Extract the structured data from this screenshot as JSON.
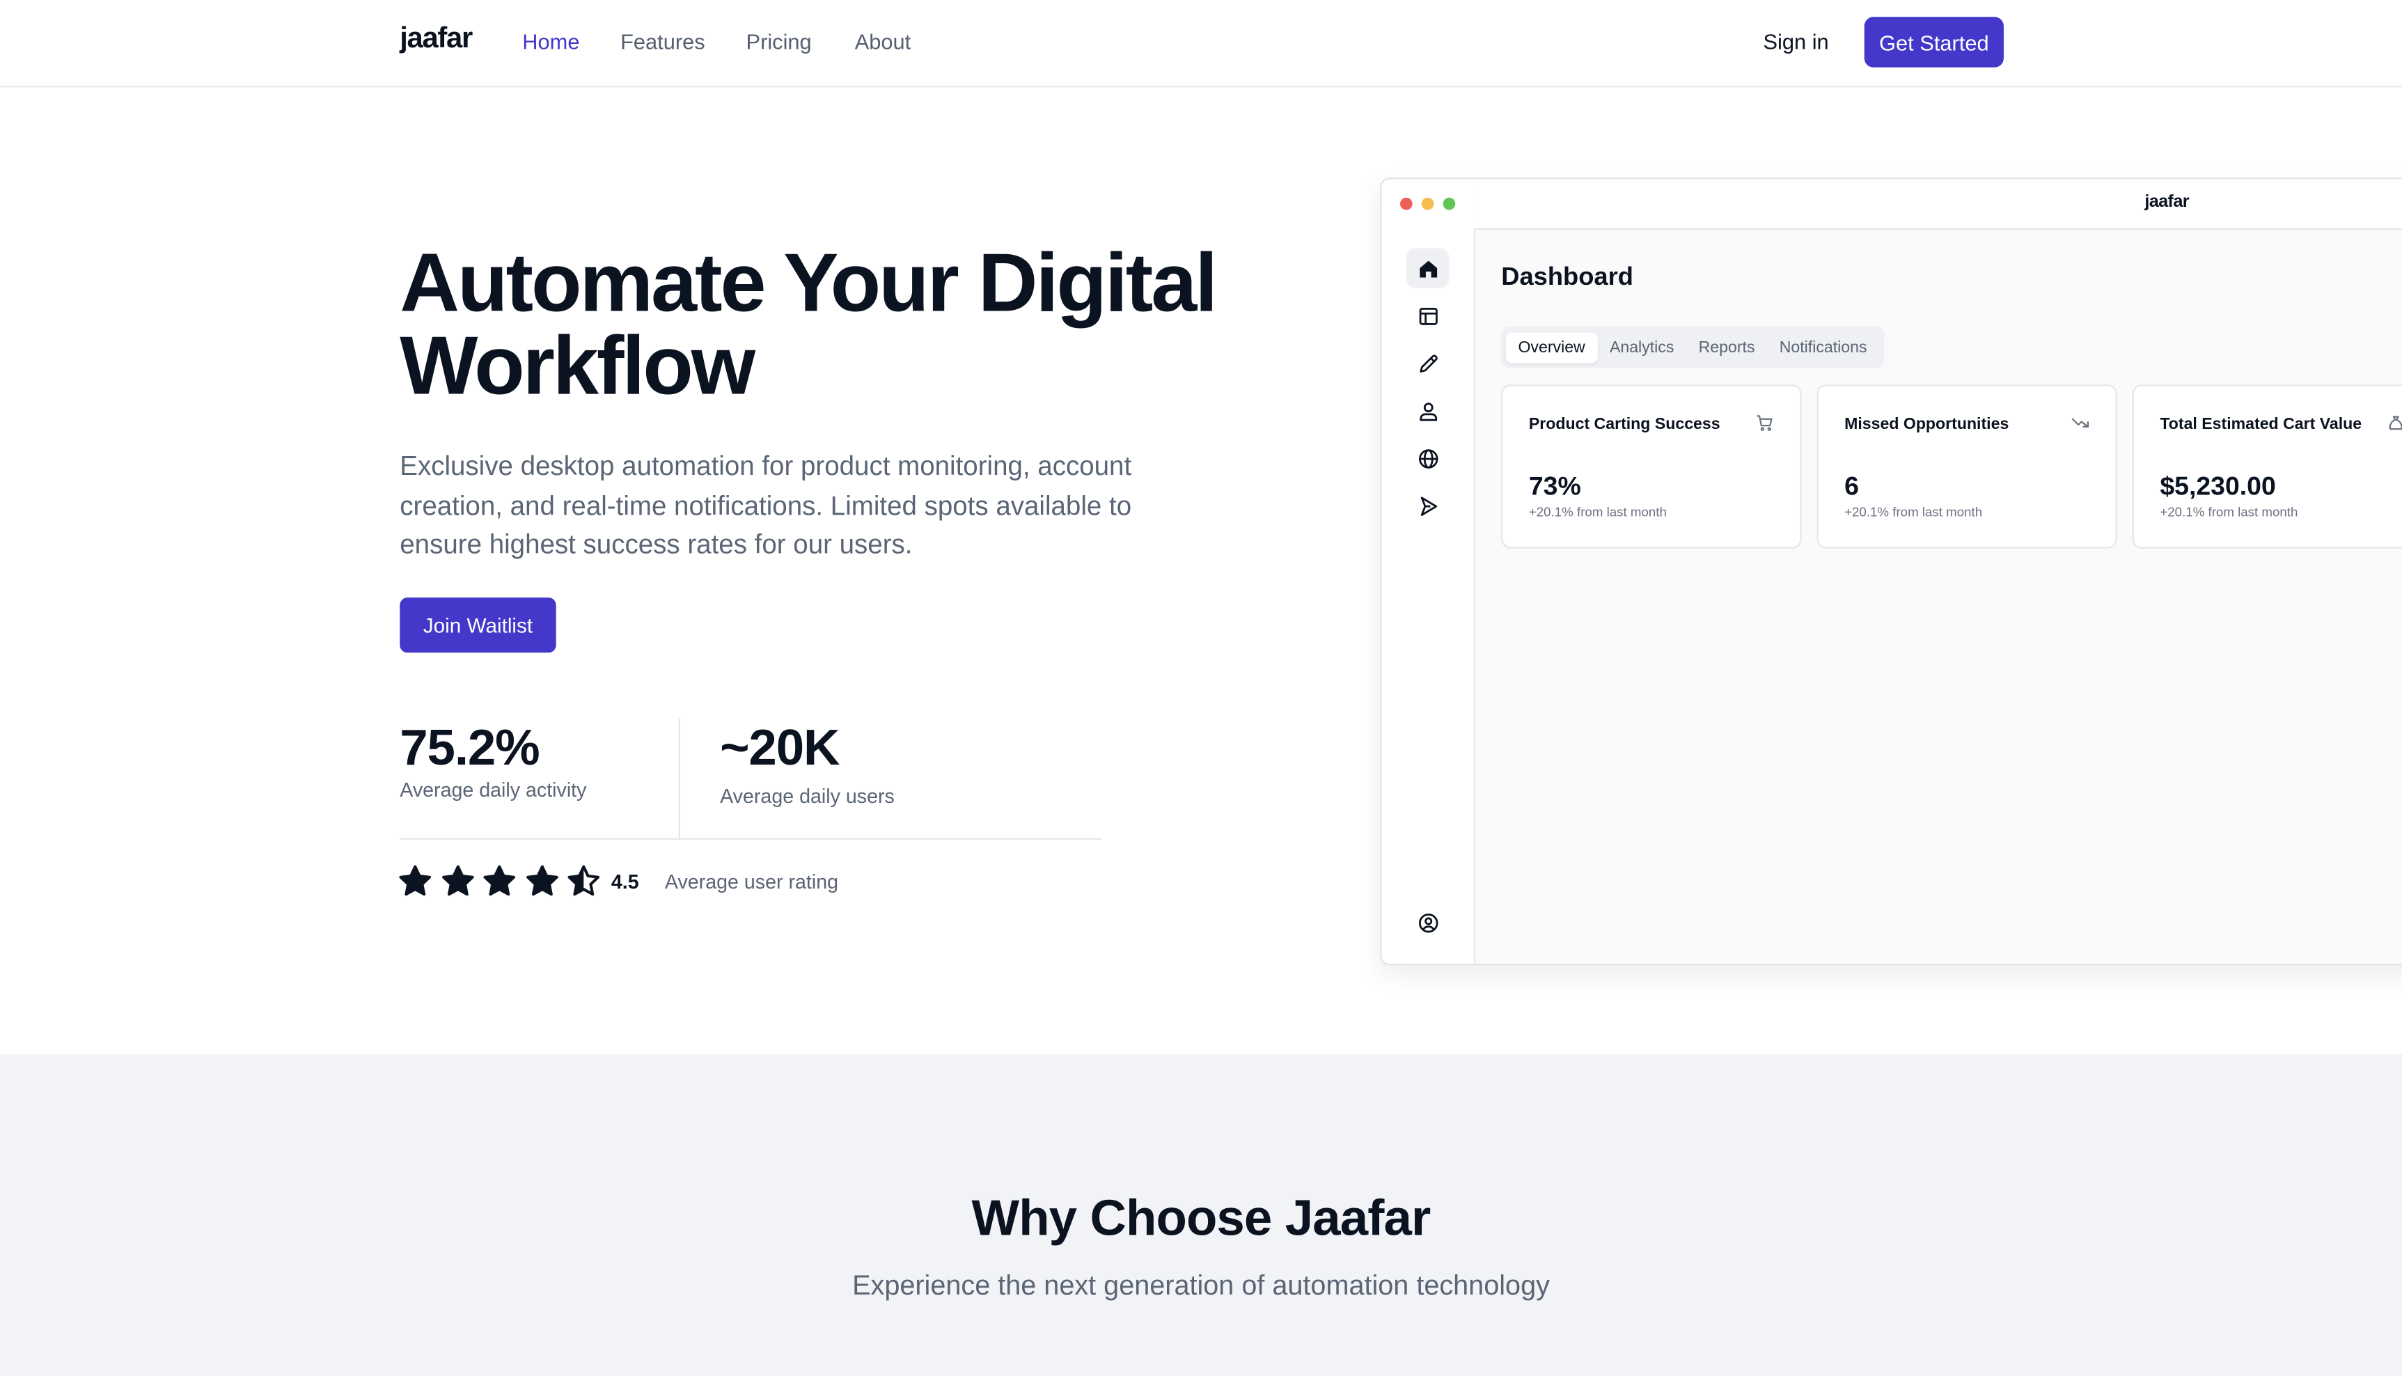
{
  "nav": {
    "logo": "jaafar",
    "links": [
      "Home",
      "Features",
      "Pricing",
      "About"
    ],
    "active_link": "Home",
    "sign_in": "Sign in",
    "cta": "Get Started"
  },
  "hero": {
    "title": "Automate Your Digital Workflow",
    "subtitle": "Exclusive desktop automation for product monitoring, account creation, and real-time notifications. Limited spots available to ensure highest success rates for our users.",
    "cta": "Join Waitlist",
    "stats": [
      {
        "value": "75.2%",
        "label": "Average daily activity"
      },
      {
        "value": "~20K",
        "label": "Average daily users"
      }
    ],
    "rating": {
      "value": "4.5",
      "stars": 4.5,
      "max": 5,
      "label": "Average user rating"
    }
  },
  "dashboard": {
    "window_controls": [
      "close",
      "minimize",
      "maximize"
    ],
    "logo": "jaafar",
    "title": "Dashboard",
    "sidebar_icons": [
      "home-icon",
      "layout-icon",
      "pencil-icon",
      "user-icon",
      "globe-icon",
      "send-icon",
      "account-circle-icon"
    ],
    "tabs": [
      "Overview",
      "Analytics",
      "Reports",
      "Notifications"
    ],
    "active_tab": "Overview",
    "cards": [
      {
        "title": "Product Carting Success",
        "value": "73%",
        "delta": "+20.1% from last month",
        "icon": "cart-icon"
      },
      {
        "title": "Missed Opportunities",
        "value": "6",
        "delta": "+20.1% from last month",
        "icon": "trend-down-icon"
      },
      {
        "title": "Total Estimated Cart Value",
        "value": "$5,230.00",
        "delta": "+20.1% from last month",
        "icon": "money-bag-icon"
      }
    ]
  },
  "why": {
    "title": "Why Choose Jaafar",
    "subtitle": "Experience the next generation of automation technology"
  },
  "colors": {
    "accent": "#4338ca",
    "text": "#0b1220",
    "muted": "#5b6575",
    "section_bg": "#f1f3f7",
    "dot_close": "#ef5f57",
    "dot_minimize": "#f4bd4f",
    "dot_maximize": "#5fc454"
  }
}
